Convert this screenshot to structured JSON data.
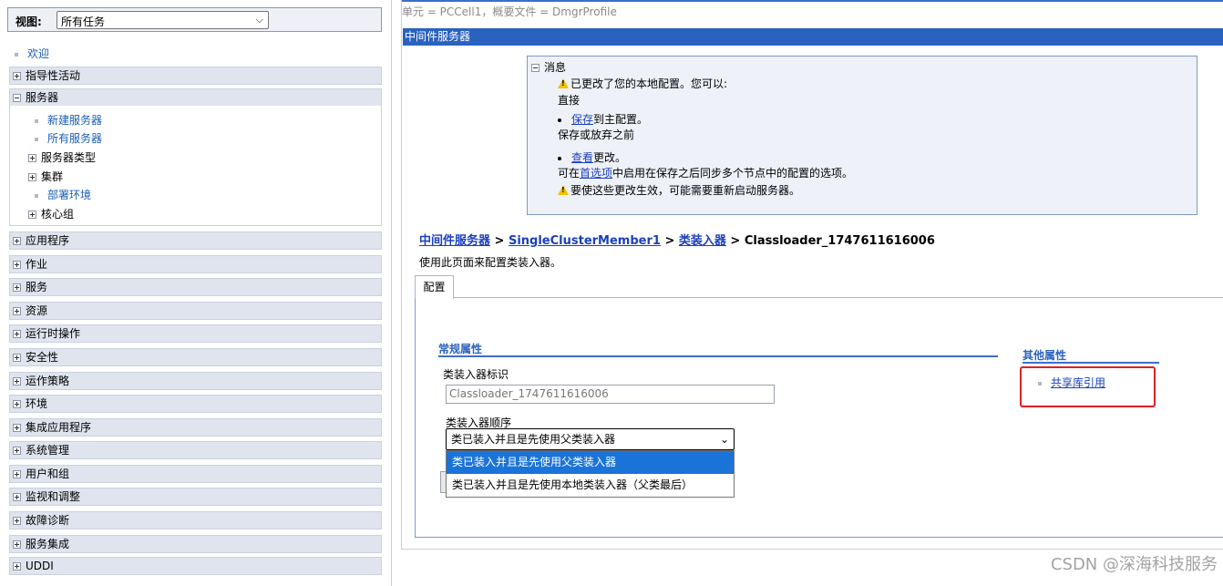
{
  "nav": {
    "view_label": "视图:",
    "view_select_value": "所有任务",
    "welcome": "欢迎",
    "categories": [
      "指导性活动",
      "服务器",
      "应用程序",
      "作业",
      "服务",
      "资源",
      "运行时操作",
      "安全性",
      "运作策略",
      "环境",
      "集成应用程序",
      "系统管理",
      "用户和组",
      "监视和调整",
      "故障诊断",
      "服务集成",
      "UDDI"
    ],
    "server_children": {
      "new_server": "新建服务器",
      "all_servers": "所有服务器",
      "server_types": "服务器类型",
      "clusters": "集群",
      "deploy_env": "部署环境",
      "core_groups": "核心组"
    }
  },
  "main": {
    "cell_info": "单元 = PCCell1，概要文件 = DmgrProfile",
    "title": "中间件服务器",
    "messages": {
      "title": "消息",
      "changed": "已更改了您的本地配置。您可以:",
      "direct": "直接",
      "save_link": "保存",
      "save_rest": "到主配置。",
      "before": "保存或放弃之前",
      "review_link": "查看",
      "review_rest": "更改。",
      "pref_pre": "可在",
      "pref_link": "首选项",
      "pref_post": "中启用在保存之后同步多个节点中的配置的选项。",
      "restart": "要使这些更改生效，可能需要重新启动服务器。"
    },
    "breadcrumb": {
      "c1": "中间件服务器",
      "sep": " > ",
      "c2": "SingleClusterMember1",
      "c3": "类装入器",
      "current": "Classloader_1747611616006"
    },
    "description": "使用此页面来配置类装入器。",
    "tab": "配置",
    "general_props": "常规属性",
    "other_props": "其他属性",
    "shared_library_link": "共享库引用",
    "classloader_id_label": "类装入器标识",
    "classloader_id_value": "Classloader_1747611616006",
    "order_label": "类装入器顺序",
    "order_value": "类已装入并且是先使用父类装入器",
    "order_options": [
      "类已装入并且是先使用父类装入器",
      "类已装入并且是先使用本地类装入器（父类最后）"
    ]
  },
  "watermark": "CSDN @深海科技服务"
}
